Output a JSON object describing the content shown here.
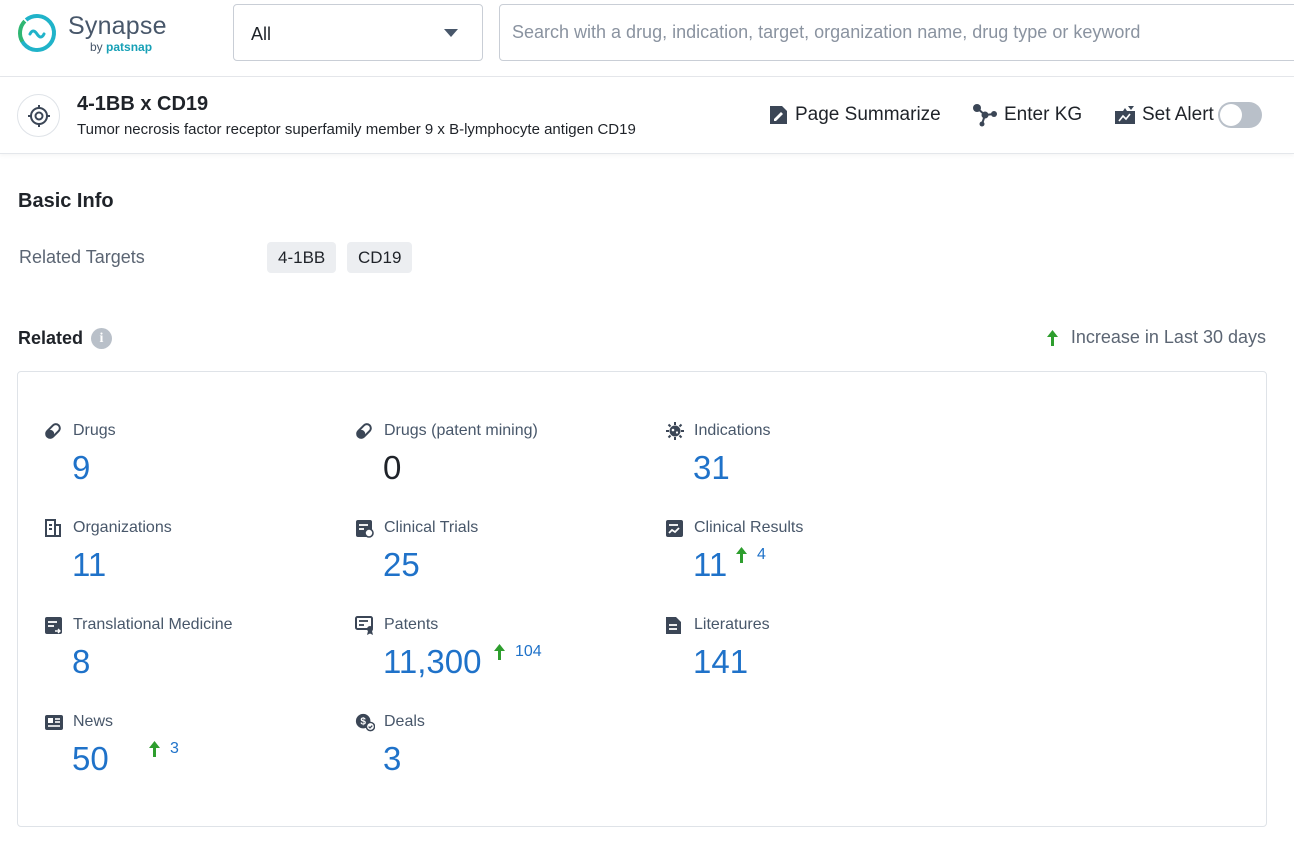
{
  "logo": {
    "name": "Synapse",
    "by": "by",
    "brand": "patsnap"
  },
  "search": {
    "scope": "All",
    "placeholder": "Search with a drug, indication, target, organization name, drug type or keyword"
  },
  "entity": {
    "title": "4-1BB x CD19",
    "subtitle": "Tumor necrosis factor receptor superfamily member 9 x B-lymphocyte antigen CD19",
    "actions": {
      "summarize": "Page Summarize",
      "kg": "Enter KG",
      "alert": "Set Alert"
    },
    "alert_enabled": false
  },
  "basic_info": {
    "title": "Basic Info",
    "related_targets_label": "Related Targets",
    "targets": [
      "4-1BB",
      "CD19"
    ]
  },
  "related": {
    "title": "Related",
    "legend": "Increase in Last 30 days",
    "stats": [
      {
        "label": "Drugs",
        "value": "9",
        "icon": "pill-icon"
      },
      {
        "label": "Drugs (patent mining)",
        "value": "0",
        "icon": "pill-icon"
      },
      {
        "label": "Indications",
        "value": "31",
        "icon": "virus-icon"
      },
      {
        "label": "Organizations",
        "value": "11",
        "icon": "building-icon"
      },
      {
        "label": "Clinical Trials",
        "value": "25",
        "icon": "clinical-trial-icon"
      },
      {
        "label": "Clinical Results",
        "value": "11",
        "increase": "4",
        "icon": "chart-report-icon"
      },
      {
        "label": "Translational Medicine",
        "value": "8",
        "icon": "report-icon"
      },
      {
        "label": "Patents",
        "value": "11,300",
        "increase": "104",
        "icon": "patent-icon"
      },
      {
        "label": "Literatures",
        "value": "141",
        "icon": "document-icon"
      },
      {
        "label": "News",
        "value": "50",
        "increase": "3",
        "icon": "newspaper-icon"
      },
      {
        "label": "Deals",
        "value": "3",
        "icon": "deal-icon"
      }
    ]
  },
  "colors": {
    "accent_blue": "#1f72c9",
    "increase_green": "#2e9e2e",
    "brand_teal": "#16a0b6"
  }
}
